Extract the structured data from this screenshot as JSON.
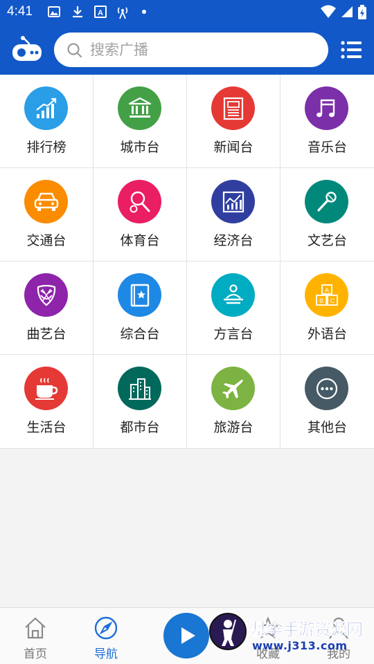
{
  "status_bar": {
    "time": "4:41"
  },
  "search": {
    "placeholder": "搜索广播"
  },
  "categories": [
    {
      "label": "排行榜",
      "icon": "trending-chart-icon",
      "color": "#2a9ee6"
    },
    {
      "label": "城市台",
      "icon": "city-hall-icon",
      "color": "#43a047"
    },
    {
      "label": "新闻台",
      "icon": "newspaper-icon",
      "color": "#e53935"
    },
    {
      "label": "音乐台",
      "icon": "music-note-icon",
      "color": "#7b2fa8"
    },
    {
      "label": "交通台",
      "icon": "car-icon",
      "color": "#fb8c00"
    },
    {
      "label": "体育台",
      "icon": "sports-racket-icon",
      "color": "#e91e63"
    },
    {
      "label": "经济台",
      "icon": "finance-chart-icon",
      "color": "#303f9f"
    },
    {
      "label": "文艺台",
      "icon": "microphone-icon",
      "color": "#00897b"
    },
    {
      "label": "曲艺台",
      "icon": "opera-mask-icon",
      "color": "#8e24aa"
    },
    {
      "label": "综合台",
      "icon": "book-star-icon",
      "color": "#1e88e5"
    },
    {
      "label": "方言台",
      "icon": "speaker-podium-icon",
      "color": "#00acc1"
    },
    {
      "label": "外语台",
      "icon": "abc-blocks-icon",
      "color": "#ffb300"
    },
    {
      "label": "生活台",
      "icon": "coffee-cup-icon",
      "color": "#e53935"
    },
    {
      "label": "都市台",
      "icon": "city-buildings-icon",
      "color": "#00695c"
    },
    {
      "label": "旅游台",
      "icon": "airplane-icon",
      "color": "#7cb342"
    },
    {
      "label": "其他台",
      "icon": "more-dots-icon",
      "color": "#455a64"
    }
  ],
  "tabs": [
    {
      "label": "首页",
      "icon": "home-icon",
      "active": false
    },
    {
      "label": "导航",
      "icon": "compass-icon",
      "active": true
    },
    {
      "label": "收藏",
      "icon": "star-icon",
      "active": false
    },
    {
      "label": "我的",
      "icon": "user-icon",
      "active": false
    }
  ],
  "watermark": {
    "title": "基伞手游资源网",
    "url": "www.j313.com"
  },
  "colors": {
    "primary": "#1258c8",
    "tab_active": "#1e6ed6",
    "play": "#1976d2"
  }
}
